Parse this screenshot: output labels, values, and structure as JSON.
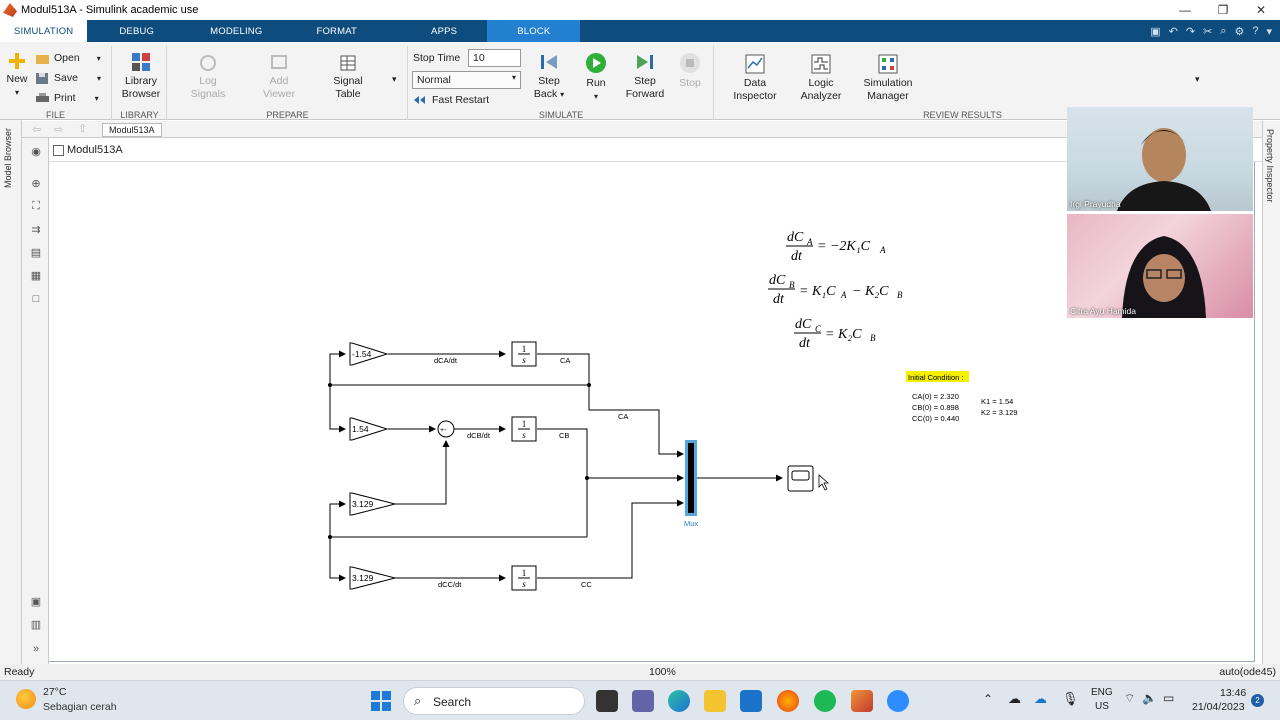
{
  "window": {
    "title": "Modul513A - Simulink academic use",
    "controls": [
      "—",
      "❐",
      "✕"
    ]
  },
  "tabs": [
    {
      "label": "SIMULATION",
      "active": true
    },
    {
      "label": "DEBUG"
    },
    {
      "label": "MODELING"
    },
    {
      "label": "FORMAT"
    },
    {
      "label": "APPS"
    },
    {
      "label": "BLOCK"
    }
  ],
  "ribbon": {
    "file": {
      "label": "FILE",
      "new": "New",
      "open": "Open",
      "save": "Save",
      "print": "Print"
    },
    "library": {
      "label": "LIBRARY",
      "browser_line1": "Library",
      "browser_line2": "Browser"
    },
    "prepare": {
      "label": "PREPARE",
      "log1": "Log",
      "log2": "Signals",
      "add1": "Add",
      "add2": "Viewer",
      "table1": "Signal",
      "table2": "Table"
    },
    "simulate": {
      "label": "SIMULATE",
      "stop_time_label": "Stop Time",
      "stop_time_value": "10",
      "mode": "Normal",
      "fast_restart": "Fast Restart",
      "step_back1": "Step",
      "step_back2": "Back",
      "run": "Run",
      "step_fwd1": "Step",
      "step_fwd2": "Forward",
      "stop": "Stop"
    },
    "review": {
      "label": "REVIEW RESULTS",
      "di1": "Data",
      "di2": "Inspector",
      "la1": "Logic",
      "la2": "Analyzer",
      "sm1": "Simulation",
      "sm2": "Manager"
    }
  },
  "side": {
    "model_browser": "Model Browser",
    "property_inspector": "Property Inspector"
  },
  "nav": {
    "tab": "Modul513A",
    "breadcrumb": "Modul513A"
  },
  "diagram": {
    "gains": [
      "-1.54",
      "1.54",
      "3.129",
      "3.129"
    ],
    "integrator_num": "1",
    "integrator_den": "s",
    "signals": {
      "dca": "dCA/dt",
      "dcb": "dCB/dt",
      "dcc": "dCC/dt",
      "ca1": "CA",
      "ca2": "CA",
      "cb": "CB",
      "cc": "CC"
    },
    "sum_signs": "+-",
    "mux": "Mux",
    "equations": {
      "eq1_num": "dC",
      "eq1_sub": "A",
      "eq1_den": "dt",
      "eq1_rhs": "= −2K₁C",
      "eq2_num": "dC",
      "eq2_sub": "B",
      "eq2_den": "dt",
      "eq2_rhs": "= K₁C",
      "eq2_rhs2": "− K₂C",
      "eq3_num": "dC",
      "eq3_sub": "C",
      "eq3_den": "dt",
      "eq3_rhs": "= K₂C"
    },
    "initial_condition_title": "Initial Condition :",
    "ic": [
      "CA(0) = 2.320",
      "CB(0) = 0.898",
      "CC(0) = 0.440"
    ],
    "k": [
      "K1 = 1.54",
      "K2 = 3.129"
    ]
  },
  "status": {
    "left": "Ready",
    "zoom": "100%",
    "solver": "auto(ode45)"
  },
  "video": {
    "p1": "Irgi Prayudha",
    "p2": "Citra Ayu Hamida"
  },
  "taskbar": {
    "temp": "27°C",
    "weather": "Sebagian cerah",
    "search": "Search",
    "lang1": "ENG",
    "lang2": "US",
    "time": "13:46",
    "date": "21/04/2023",
    "notif": "2"
  },
  "colors": {
    "tabbar": "#0e4c7e",
    "block_tab": "#2380d0",
    "highlight": "#f5f000",
    "mux": "#000000"
  }
}
